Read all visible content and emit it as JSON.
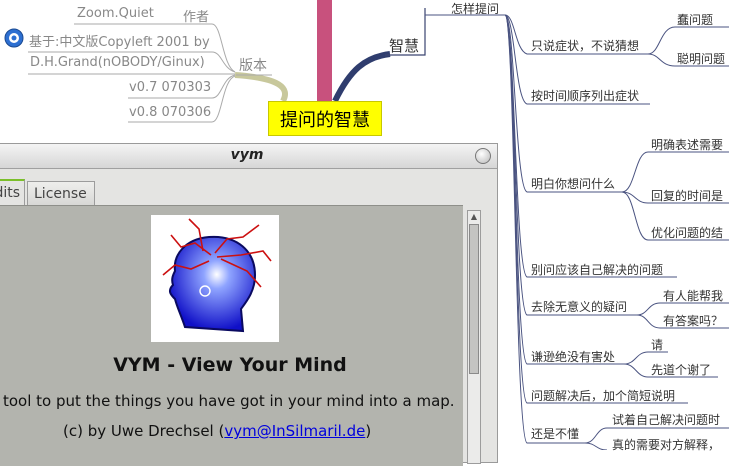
{
  "mindmap": {
    "center": "提问的智慧",
    "left": {
      "translator": "Zoom.Quiet",
      "translator_role": "作者",
      "based_on": "基于:中文版Copyleft 2001 by",
      "based_on_author": "D.H.Grand(nOBODY/Ginux)",
      "version_label": "版本",
      "versions": [
        "v0.7 070303",
        "v0.8 070306"
      ]
    },
    "right": {
      "branch": "智慧",
      "how_to_ask": "怎样提问",
      "symptoms": "只说症状，不说猜想",
      "symptoms_children": [
        "蠢问题",
        "聪明问题"
      ],
      "chronological": "按时间顺序列出症状",
      "clarify": "明白你想问什么",
      "clarify_children": [
        "明确表述需要",
        "回复的时间是",
        "优化问题的结"
      ],
      "solve_yourself": "别问应该自己解决的问题",
      "no_pointless": "去除无意义的疑问",
      "no_pointless_children": [
        "有人能帮我",
        "有答案吗？"
      ],
      "polite": "谦逊绝没有害处",
      "polite_children": [
        "请",
        "先道个谢了"
      ],
      "after_solved": "问题解决后，加个简短说明",
      "dont_understand": "还是不懂",
      "dont_understand_children": [
        "试着自己解决问题时",
        "真的需要对方解释，"
      ]
    }
  },
  "dialog": {
    "title": "vym",
    "tabs": [
      "dits",
      "License"
    ],
    "app_name": "VYM - View Your Mind",
    "description": "tool to put the things you have got in your mind into a map.",
    "author_prefix": "(c) by Uwe Drechsel (",
    "author_email": "vym@InSilmaril.de",
    "author_suffix": ")"
  },
  "icons": {
    "close": "close-icon",
    "based_on": "globe-icon",
    "logo": "vym-head-logo"
  },
  "colors": {
    "center_bg": "#ffff00",
    "trunk": "#c8517d",
    "branch": "#2f3d6e",
    "link": "#0000dd"
  }
}
